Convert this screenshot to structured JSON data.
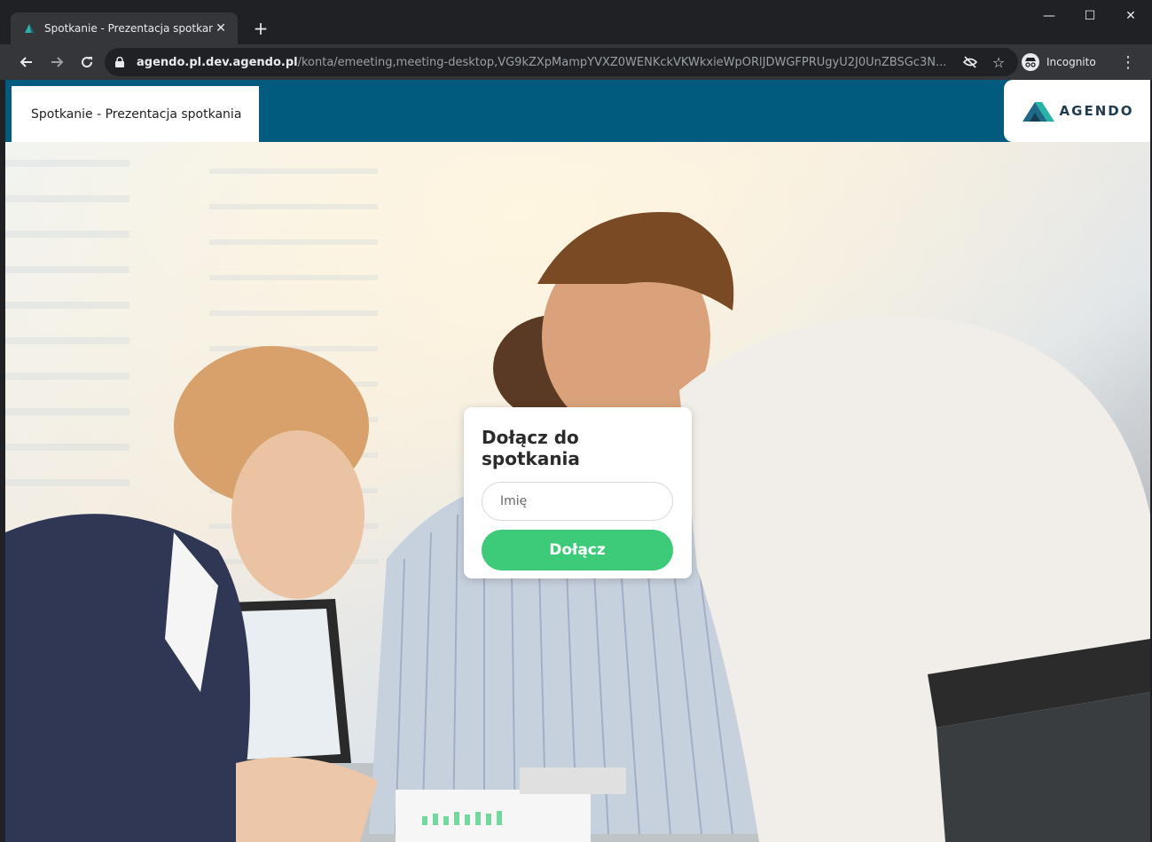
{
  "browser": {
    "tab_title": "Spotkanie - Prezentacja spotkania",
    "tab_close": "✕",
    "new_tab": "+",
    "window_controls": {
      "minimize": "—",
      "maximize": "☐",
      "close": "✕"
    },
    "url_host": "agendo.pl.dev.agendo.pl",
    "url_path": "/konta/emeeting,meeting-desktop,VG9kZXpMampYVXZ0WENKckVKWkxieWpORlJDWGFPRUgyU2J0UnZBSGc3N...",
    "profile_label": "Incognito",
    "colors": {
      "chrome_dark": "#202124",
      "toolbar": "#35363a"
    }
  },
  "page": {
    "tab_label": "Spotkanie - Prezentacja spotkania",
    "logo_text": "AGENDO",
    "header_color": "#005b7f",
    "join": {
      "heading": "Dołącz do spotkania",
      "name_placeholder": "Imię",
      "name_value": "",
      "join_button": "Dołącz",
      "button_color": "#3dcb7a"
    }
  }
}
